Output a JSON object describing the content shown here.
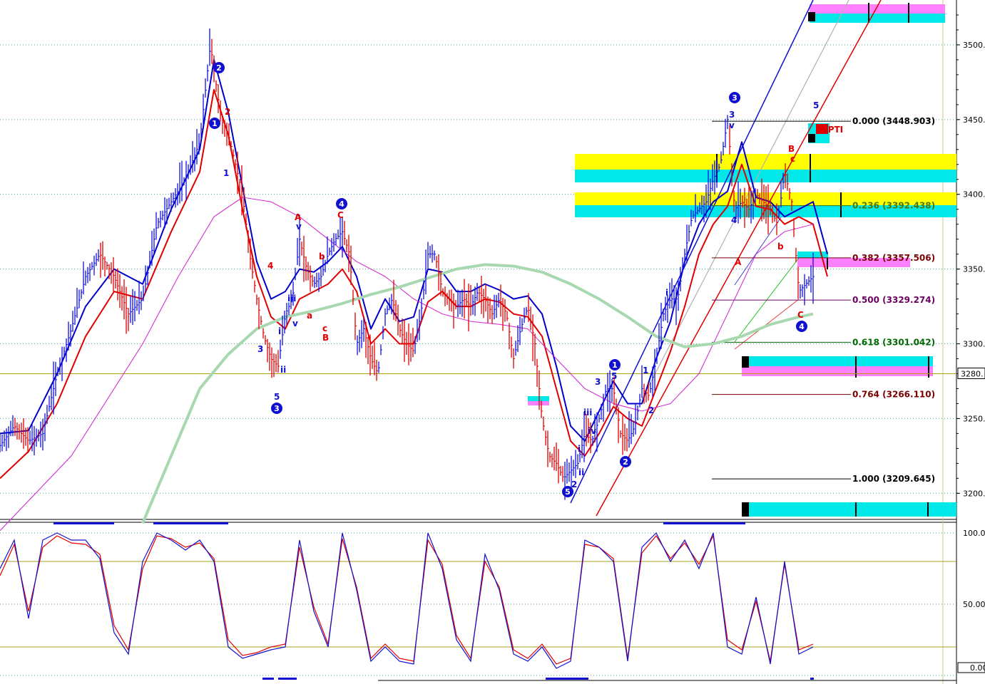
{
  "chart_data": {
    "type": "line",
    "price_axis": {
      "ticks": [
        "3500.",
        "3450.",
        "3400.",
        "3350.",
        "3300.",
        "3250.",
        "3200."
      ],
      "tick_values": [
        3500,
        3450,
        3400,
        3350,
        3300,
        3250,
        3200
      ],
      "ylim": [
        3183,
        3530
      ],
      "marker_label": "3280.",
      "marker_value": 3280
    },
    "osc_axis": {
      "ticks": [
        "100.0",
        "50.00"
      ],
      "tick_values": [
        100,
        50
      ],
      "ylim": [
        -2,
        106
      ],
      "current_label": "0.00",
      "guide_levels": [
        80,
        20
      ]
    },
    "fib_levels": [
      {
        "label": "0.000 (3448.903)",
        "value": 3448.903,
        "color": "#000000"
      },
      {
        "label": "0.236 (3392.438)",
        "value": 3392.438,
        "color": "#4a7a00"
      },
      {
        "label": "0.382 (3357.506)",
        "value": 3357.506,
        "color": "#7a0000"
      },
      {
        "label": "0.500 (3329.274)",
        "value": 3329.274,
        "color": "#6a0060"
      },
      {
        "label": "0.618 (3301.042)",
        "value": 3301.042,
        "color": "#006a00"
      },
      {
        "label": "0.764 (3266.110)",
        "value": 3266.11,
        "color": "#7a0000"
      },
      {
        "label": "1.000 (3209.645)",
        "value": 3209.645,
        "color": "#000000"
      }
    ],
    "series": [
      {
        "name": "price",
        "color": "#1010e0",
        "x": [
          0,
          20,
          40,
          60,
          80,
          100,
          120,
          140,
          160,
          180,
          200,
          220,
          240,
          260,
          280,
          295,
          310,
          320,
          330,
          340,
          350,
          360,
          370,
          380,
          390,
          400,
          410,
          420,
          430,
          440,
          450,
          460,
          470,
          480,
          490,
          500,
          510,
          520,
          530,
          540,
          550,
          560,
          570,
          580,
          590,
          600,
          610,
          620,
          630,
          640,
          650,
          660,
          670,
          680,
          690,
          700,
          710,
          720,
          730,
          740,
          750,
          760,
          770,
          780,
          790,
          800,
          810,
          820,
          830,
          840,
          850,
          860,
          870,
          880,
          890,
          900,
          910,
          920,
          930,
          940,
          950,
          960,
          970,
          980,
          990,
          1000,
          1010,
          1020,
          1030,
          1040,
          1050,
          1060,
          1070,
          1080,
          1090,
          1100,
          1110,
          1120,
          1130,
          1140
        ],
        "y": [
          3232,
          3245,
          3235,
          3240,
          3280,
          3310,
          3345,
          3360,
          3345,
          3320,
          3330,
          3380,
          3395,
          3410,
          3435,
          3500,
          3450,
          3440,
          3420,
          3400,
          3360,
          3330,
          3305,
          3290,
          3285,
          3320,
          3330,
          3370,
          3350,
          3340,
          3345,
          3360,
          3370,
          3375,
          3360,
          3300,
          3310,
          3290,
          3280,
          3320,
          3330,
          3310,
          3300,
          3295,
          3320,
          3360,
          3360,
          3335,
          3330,
          3325,
          3330,
          3325,
          3335,
          3330,
          3320,
          3330,
          3320,
          3290,
          3310,
          3325,
          3300,
          3250,
          3225,
          3220,
          3210,
          3215,
          3220,
          3240,
          3235,
          3250,
          3270,
          3270,
          3240,
          3235,
          3245,
          3270,
          3265,
          3290,
          3320,
          3330,
          3330,
          3360,
          3385,
          3390,
          3395,
          3410,
          3420,
          3450,
          3390,
          3395,
          3390,
          3400,
          3395,
          3390,
          3380,
          3415,
          3395,
          3335,
          3340,
          3345
        ]
      },
      {
        "name": "ma_fast_blue",
        "color": "#0000c8",
        "x": [
          0,
          40,
          80,
          120,
          160,
          200,
          240,
          280,
          300,
          320,
          340,
          360,
          380,
          400,
          420,
          440,
          460,
          480,
          500,
          520,
          540,
          560,
          580,
          600,
          620,
          640,
          660,
          680,
          700,
          720,
          740,
          760,
          780,
          800,
          820,
          840,
          860,
          880,
          900,
          920,
          940,
          960,
          980,
          1000,
          1020,
          1040,
          1060,
          1080,
          1100,
          1120,
          1140,
          1160
        ],
        "y": [
          3240,
          3242,
          3280,
          3325,
          3350,
          3340,
          3390,
          3430,
          3490,
          3455,
          3405,
          3355,
          3330,
          3335,
          3350,
          3348,
          3355,
          3365,
          3345,
          3310,
          3330,
          3315,
          3318,
          3350,
          3348,
          3335,
          3335,
          3340,
          3336,
          3330,
          3332,
          3320,
          3285,
          3245,
          3235,
          3255,
          3275,
          3260,
          3260,
          3290,
          3315,
          3355,
          3380,
          3395,
          3402,
          3435,
          3398,
          3395,
          3385,
          3390,
          3395,
          3360
        ]
      },
      {
        "name": "ma_fast_red",
        "color": "#e00000",
        "x": [
          0,
          40,
          80,
          120,
          160,
          200,
          240,
          280,
          300,
          320,
          340,
          360,
          380,
          400,
          420,
          440,
          460,
          480,
          500,
          520,
          540,
          560,
          580,
          600,
          620,
          640,
          660,
          680,
          700,
          720,
          740,
          760,
          780,
          800,
          820,
          840,
          860,
          880,
          900,
          920,
          940,
          960,
          980,
          1000,
          1020,
          1040,
          1060,
          1080,
          1100,
          1120,
          1140,
          1160
        ],
        "y": [
          3210,
          3228,
          3260,
          3305,
          3335,
          3330,
          3375,
          3415,
          3470,
          3440,
          3390,
          3345,
          3318,
          3310,
          3330,
          3335,
          3340,
          3350,
          3335,
          3300,
          3310,
          3300,
          3300,
          3328,
          3335,
          3325,
          3325,
          3330,
          3328,
          3320,
          3318,
          3305,
          3270,
          3235,
          3225,
          3240,
          3258,
          3250,
          3245,
          3270,
          3295,
          3325,
          3360,
          3380,
          3392,
          3420,
          3392,
          3390,
          3380,
          3385,
          3380,
          3345
        ]
      },
      {
        "name": "ma_slow_magenta",
        "color": "#d020d0",
        "x": [
          0,
          100,
          200,
          250,
          300,
          340,
          380,
          420,
          460,
          500,
          540,
          580,
          620,
          660,
          700,
          740,
          780,
          820,
          860,
          900,
          940,
          980,
          1020,
          1060,
          1100,
          1140
        ],
        "y": [
          3175,
          3225,
          3300,
          3345,
          3385,
          3398,
          3395,
          3385,
          3370,
          3355,
          3345,
          3330,
          3320,
          3315,
          3313,
          3310,
          3290,
          3270,
          3260,
          3255,
          3260,
          3280,
          3320,
          3360,
          3375,
          3380
        ]
      },
      {
        "name": "ma_green",
        "color": "#a8d8b0",
        "x": [
          200,
          240,
          280,
          320,
          360,
          400,
          440,
          480,
          520,
          560,
          600,
          640,
          680,
          720,
          760,
          800,
          840,
          880,
          920,
          960,
          1000,
          1040,
          1080,
          1120,
          1140
        ],
        "y": [
          3180,
          3225,
          3270,
          3293,
          3310,
          3318,
          3322,
          3327,
          3333,
          3338,
          3344,
          3350,
          3353,
          3352,
          3348,
          3340,
          3330,
          3318,
          3305,
          3298,
          3300,
          3305,
          3313,
          3318,
          3320
        ]
      }
    ],
    "oscillator": {
      "x": [
        0,
        20,
        40,
        60,
        80,
        100,
        120,
        140,
        160,
        180,
        200,
        220,
        240,
        260,
        280,
        300,
        320,
        340,
        360,
        380,
        400,
        420,
        440,
        460,
        480,
        500,
        520,
        540,
        560,
        580,
        600,
        620,
        640,
        660,
        680,
        700,
        720,
        740,
        760,
        780,
        800,
        820,
        840,
        860,
        880,
        900,
        920,
        940,
        960,
        980,
        1000,
        1020,
        1040,
        1060,
        1080,
        1100,
        1120,
        1140
      ],
      "k": [
        75,
        95,
        40,
        95,
        100,
        95,
        95,
        82,
        30,
        15,
        80,
        100,
        95,
        88,
        95,
        80,
        20,
        12,
        15,
        18,
        20,
        95,
        45,
        20,
        100,
        60,
        10,
        20,
        10,
        8,
        100,
        75,
        25,
        10,
        85,
        60,
        15,
        10,
        20,
        5,
        10,
        95,
        90,
        80,
        10,
        90,
        100,
        80,
        95,
        75,
        100,
        20,
        15,
        55,
        8,
        80,
        15,
        20
      ],
      "d": [
        70,
        92,
        45,
        90,
        98,
        93,
        92,
        85,
        35,
        18,
        75,
        98,
        96,
        90,
        93,
        82,
        25,
        14,
        16,
        20,
        22,
        90,
        48,
        22,
        96,
        62,
        12,
        22,
        12,
        10,
        95,
        78,
        28,
        12,
        80,
        62,
        18,
        12,
        22,
        8,
        12,
        92,
        90,
        82,
        12,
        86,
        98,
        82,
        93,
        78,
        98,
        25,
        18,
        52,
        10,
        78,
        18,
        22
      ]
    },
    "wave_labels": [
      "1",
      "2",
      "3",
      "4",
      "5",
      "A",
      "B",
      "C",
      "a",
      "b",
      "c",
      "i",
      "ii",
      "iii",
      "iv",
      "v"
    ],
    "annotation": "38PTI"
  }
}
